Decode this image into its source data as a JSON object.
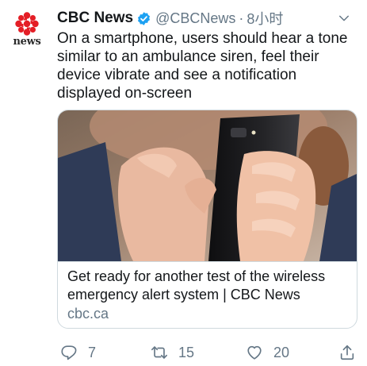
{
  "account": {
    "avatar_wordmark": "news",
    "display_name": "CBC News",
    "handle": "@CBCNews",
    "separator": "·",
    "timestamp": "8小时",
    "verified": true
  },
  "tweet": {
    "text": "On a smartphone, users should hear a tone similar to an ambulance siren, feel their device vibrate and see a notification displayed on-screen"
  },
  "card": {
    "image_subject": "hands holding a black smartphone",
    "title": "Get ready for another test of the wireless emergency alert system | CBC News",
    "domain": "cbc.ca"
  },
  "actions": {
    "reply_count": "7",
    "retweet_count": "15",
    "like_count": "20"
  },
  "colors": {
    "brand_red": "#e41e26",
    "verified_blue": "#1da1f2",
    "secondary_text": "#657786",
    "primary_text": "#14171a",
    "border": "#cfd9de"
  },
  "icons": [
    "cbc-gem-icon",
    "verified-badge-icon",
    "chevron-down-icon",
    "reply-icon",
    "retweet-icon",
    "like-icon",
    "share-icon"
  ]
}
